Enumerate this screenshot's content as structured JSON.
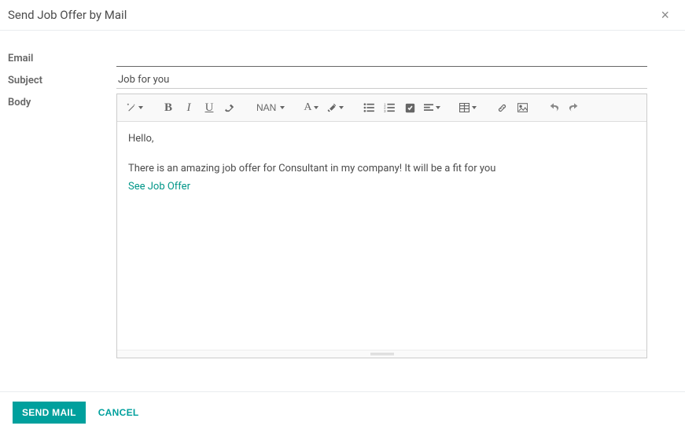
{
  "header": {
    "title": "Send Job Offer by Mail"
  },
  "form": {
    "email_label": "Email",
    "email_value": "",
    "subject_label": "Subject",
    "subject_value": "Job for you",
    "body_label": "Body"
  },
  "toolbar": {
    "font_size_label": "NAN"
  },
  "body": {
    "greeting": "Hello,",
    "line1": "There is an amazing job offer for Consultant in my company! It will be a fit for you",
    "link_text": "See Job Offer"
  },
  "footer": {
    "send_label": "SEND MAIL",
    "cancel_label": "CANCEL"
  }
}
